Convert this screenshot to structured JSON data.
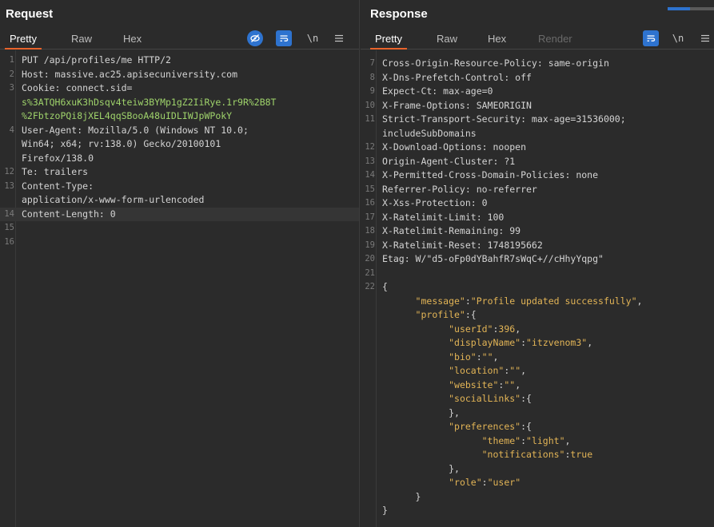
{
  "request": {
    "title": "Request",
    "tabs": [
      "Pretty",
      "Raw",
      "Hex"
    ],
    "tools": [
      "eye-off-icon",
      "wrap-icon",
      "\\n",
      "menu-icon"
    ],
    "lines": [
      {
        "n": "1",
        "t": "PUT /api/profiles/me HTTP/2"
      },
      {
        "n": "2",
        "t": "Host: massive.ac25.apisecuniversity.com"
      },
      {
        "n": "3",
        "t": "Cookie: connect.sid=",
        "c": "g"
      },
      {
        "n": "",
        "t": "s%3ATQH6xuK3hDsqv4teiw3BYMp1gZ2IiRye.1r9R%2B8T",
        "c": "gval"
      },
      {
        "n": "",
        "t": "%2FbtzoPQi8jXEL4qqSBooA48uIDLIWJpWPokY",
        "c": "gval"
      },
      {
        "n": "4",
        "t": "User-Agent: Mozilla/5.0 (Windows NT 10.0;"
      },
      {
        "n": "",
        "t": "Win64; x64; rv:138.0) Gecko/20100101"
      },
      {
        "n": "",
        "t": "Firefox/138.0"
      },
      {
        "n": "12",
        "t": "Te: trailers"
      },
      {
        "n": "13",
        "t": "Content-Type:"
      },
      {
        "n": "",
        "t": "application/x-www-form-urlencoded"
      },
      {
        "n": "14",
        "t": "Content-Length: 0",
        "hl": true
      },
      {
        "n": "15",
        "t": ""
      },
      {
        "n": "16",
        "t": ""
      }
    ]
  },
  "response": {
    "title": "Response",
    "tabs": [
      "Pretty",
      "Raw",
      "Hex",
      "Render"
    ],
    "tools": [
      "wrap-icon",
      "\\n",
      "menu-icon"
    ],
    "lines": [
      {
        "n": "7",
        "t": "Cross-Origin-Resource-Policy: same-origin"
      },
      {
        "n": "8",
        "t": "X-Dns-Prefetch-Control: off"
      },
      {
        "n": "9",
        "t": "Expect-Ct: max-age=0"
      },
      {
        "n": "10",
        "t": "X-Frame-Options: SAMEORIGIN"
      },
      {
        "n": "11",
        "t": "Strict-Transport-Security: max-age=31536000;"
      },
      {
        "n": "",
        "t": "includeSubDomains"
      },
      {
        "n": "12",
        "t": "X-Download-Options: noopen"
      },
      {
        "n": "13",
        "t": "Origin-Agent-Cluster: ?1"
      },
      {
        "n": "14",
        "t": "X-Permitted-Cross-Domain-Policies: none"
      },
      {
        "n": "15",
        "t": "Referrer-Policy: no-referrer"
      },
      {
        "n": "16",
        "t": "X-Xss-Protection: 0"
      },
      {
        "n": "17",
        "t": "X-Ratelimit-Limit: 100"
      },
      {
        "n": "18",
        "t": "X-Ratelimit-Remaining: 99"
      },
      {
        "n": "19",
        "t": "X-Ratelimit-Reset: 1748195662"
      },
      {
        "n": "20",
        "t": "Etag: W/\"d5-oFp0dYBahfR7sWqC+//cHhyYqpg\""
      },
      {
        "n": "21",
        "t": ""
      },
      {
        "n": "22",
        "t": "{"
      },
      {
        "n": "",
        "t": "      \"message\":\"Profile updated successfully\","
      },
      {
        "n": "",
        "t": "      \"profile\":{"
      },
      {
        "n": "",
        "t": "            \"userId\":396,"
      },
      {
        "n": "",
        "t": "            \"displayName\":\"itzvenom3\","
      },
      {
        "n": "",
        "t": "            \"bio\":\"\","
      },
      {
        "n": "",
        "t": "            \"location\":\"\","
      },
      {
        "n": "",
        "t": "            \"website\":\"\","
      },
      {
        "n": "",
        "t": "            \"socialLinks\":{"
      },
      {
        "n": "",
        "t": "            },"
      },
      {
        "n": "",
        "t": "            \"preferences\":{"
      },
      {
        "n": "",
        "t": "                  \"theme\":\"light\","
      },
      {
        "n": "",
        "t": "                  \"notifications\":true"
      },
      {
        "n": "",
        "t": "            },"
      },
      {
        "n": "",
        "t": "            \"role\":\"user\""
      },
      {
        "n": "",
        "t": "      }"
      },
      {
        "n": "",
        "t": "}"
      }
    ]
  },
  "colors": {
    "accent": "#e8632b",
    "tool_blue": "#2e73cf",
    "json_key": "#e2b456",
    "cookie_val": "#9fd36b"
  }
}
